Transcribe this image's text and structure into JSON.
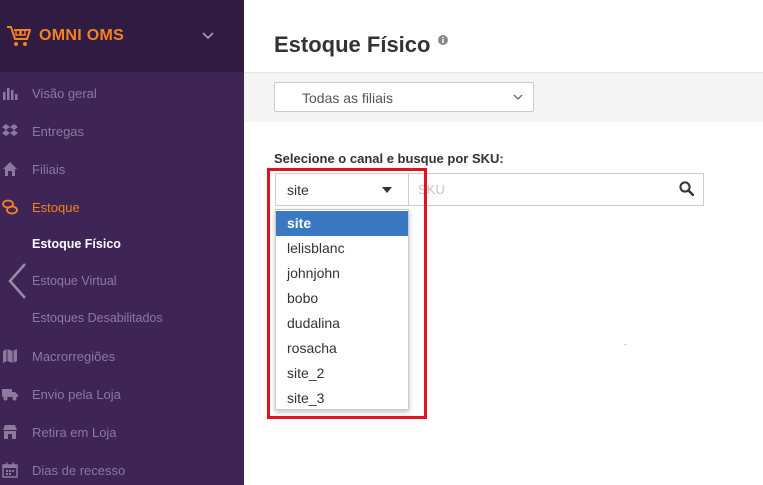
{
  "app": {
    "brand": "OMNI OMS"
  },
  "colors": {
    "sidebar_bg": "#3f2456",
    "brand_bg": "#301b42",
    "accent": "#f5821f",
    "selected_option": "#3a78c2",
    "highlight": "#e0141f"
  },
  "sidebar": {
    "items": [
      {
        "label": "Visão geral",
        "icon": "bar-chart-icon"
      },
      {
        "label": "Entregas",
        "icon": "dropbox-icon"
      },
      {
        "label": "Filiais",
        "icon": "home-icon"
      },
      {
        "label": "Estoque",
        "icon": "coins-icon"
      },
      {
        "label": "Estoque Físico"
      },
      {
        "label": "Estoque Virtual"
      },
      {
        "label": "Estoques Desabilitados"
      },
      {
        "label": "Macrorregiões",
        "icon": "map-icon"
      },
      {
        "label": "Envio pela Loja",
        "icon": "truck-icon"
      },
      {
        "label": "Retira em Loja",
        "icon": "store-icon"
      },
      {
        "label": "Dias de recesso",
        "icon": "calendar-icon"
      }
    ]
  },
  "main": {
    "title": "Estoque Físico",
    "branch_filter": {
      "value": "Todas as filiais"
    },
    "channel_label": "Selecione o canal e busque por SKU:",
    "channel_select": {
      "value": "site"
    },
    "sku_input": {
      "placeholder": "SKU",
      "value": ""
    },
    "channel_options": [
      "site",
      "lelisblanc",
      "johnjohn",
      "bobo",
      "dudalina",
      "rosacha",
      "site_2",
      "site_3"
    ]
  }
}
